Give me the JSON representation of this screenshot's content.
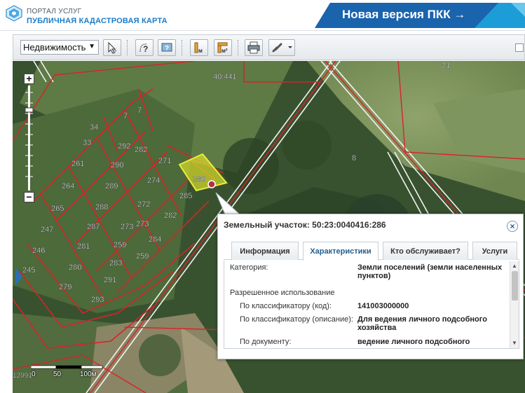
{
  "header": {
    "portal_label": "ПОРТАЛ УСЛУГ",
    "app_title": "ПУБЛИЧНАЯ КАДАСТРОВАЯ КАРТА",
    "new_version_label": "Новая версия ПКК →",
    "colors": {
      "brand_blue": "#1c7cc9",
      "banner": "#1a63ad",
      "banner_accent": "#1fb0e6"
    }
  },
  "toolbar": {
    "layer_select_value": "Недвижимость",
    "icons": [
      "select-arrow-icon",
      "identify-icon",
      "search-area-icon",
      "measure-length-icon",
      "measure-area-icon",
      "print-icon",
      "link-icon"
    ]
  },
  "map": {
    "parcel_labels": [
      "40:441",
      "21",
      "7",
      "7",
      "34",
      "33",
      "292",
      "282",
      "271",
      "286",
      "261",
      "290",
      "274",
      "285",
      "8",
      "264",
      "289",
      "272",
      "265",
      "288",
      "282",
      "273",
      "273",
      "247",
      "287",
      "284",
      "246",
      "281",
      "259",
      "245",
      "280",
      "283",
      "259",
      "279",
      "291",
      "293",
      "12091"
    ],
    "scale_labels": {
      "zero": "0",
      "mid": "50",
      "end": "100м"
    },
    "colors": {
      "parcel_border": "#d8232a",
      "highlight": "#d9e02a"
    }
  },
  "popup": {
    "title": "Земельный участок: 50:23:0040416:286",
    "close_label": "×",
    "tabs": [
      "Информация",
      "Характеристики",
      "Кто обслуживает?",
      "Услуги"
    ],
    "active_tab": "Характеристики",
    "category_label": "Категория:",
    "category_value": "Земли поселений (земли населенных пунктов)",
    "permitted_use_label": "Разрешенное использование",
    "by_code_label": "По классификатору (код):",
    "by_code_value": "141003000000",
    "by_desc_label": "По классификатору (описание):",
    "by_desc_value": "Для ведения личного подсобного хозяйства",
    "by_doc_label": "По документу:",
    "by_doc_value": "ведение личного подсобного"
  }
}
